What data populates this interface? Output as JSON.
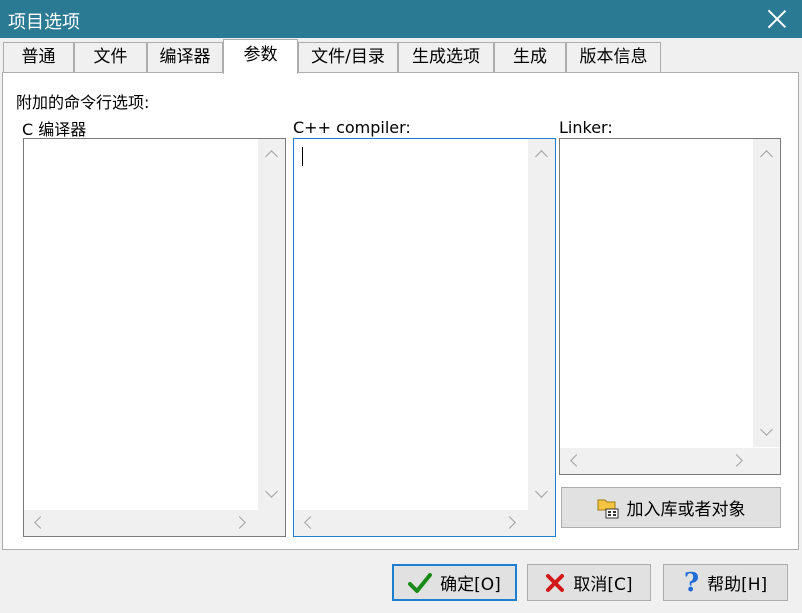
{
  "window": {
    "title": "项目选项"
  },
  "tabs": [
    "普通",
    "文件",
    "编译器",
    "参数",
    "文件/目录",
    "生成选项",
    "生成",
    "版本信息"
  ],
  "params": {
    "heading": "附加的命令行选项:",
    "c_label": "C 编译器",
    "cpp_label": "C++ compiler:",
    "linker_label": "Linker:",
    "add_library_button": "加入库或者对象"
  },
  "footer": {
    "ok": "确定[O]",
    "cancel": "取消[C]",
    "help": "帮助[H]"
  },
  "colors": {
    "titlebar": "#2b7a93",
    "focus": "#1e7fd0"
  }
}
